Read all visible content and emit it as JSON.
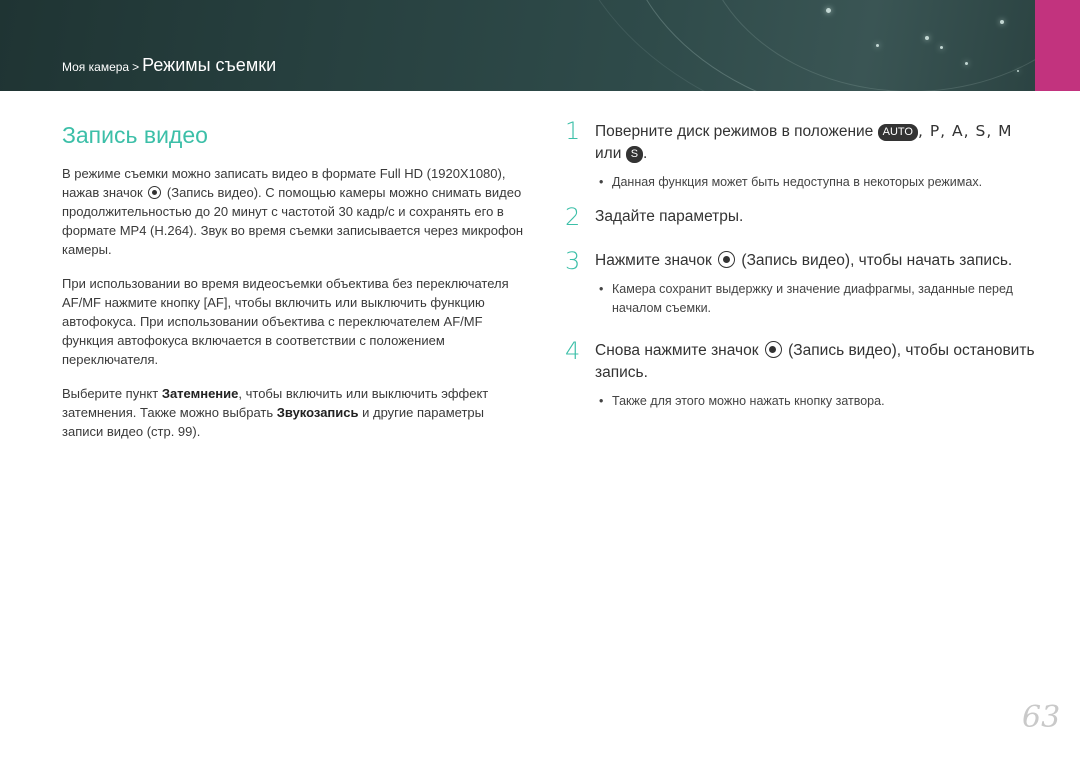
{
  "header": {
    "breadcrumb_parent": "Моя камера",
    "breadcrumb_separator": ">",
    "breadcrumb_current": "Режимы съемки"
  },
  "section": {
    "title": "Запись видео"
  },
  "left": {
    "p1_a": "В режиме съемки можно записать видео в формате Full HD (1920X1080), нажав значок",
    "p1_b": "(Запись видео). С помощью камеры можно снимать видео продолжительностью до 20 минут с частотой 30 кадр/с и сохранять его в формате MP4 (H.264). Звук во время съемки записывается через микрофон камеры.",
    "p2_a": "При использовании во время видеосъемки объектива без переключателя AF/MF нажмите кнопку [",
    "p2_af": "AF",
    "p2_b": "], чтобы включить или выключить функцию автофокуса. При использовании объектива с переключателем AF/MF функция автофокуса включается в соответствии с положением переключателя.",
    "p3_a": "Выберите пункт ",
    "p3_bold1": "Затемнение",
    "p3_b": ", чтобы включить или выключить эффект затемнения. Также можно выбрать ",
    "p3_bold2": "Звукозапись",
    "p3_c": " и другие параметры записи видео (стр. 99)."
  },
  "steps": [
    {
      "num": "1",
      "text_a": "Поверните диск режимов в положение ",
      "badge": "AUTO",
      "letters": ", P, A, S, M",
      "text_b": "или",
      "badge2": "S",
      "text_c": ".",
      "note": "Данная функция может быть недоступна в некоторых режимах."
    },
    {
      "num": "2",
      "text": "Задайте параметры."
    },
    {
      "num": "3",
      "text_a": "Нажмите значок",
      "text_b": "(Запись видео), чтобы начать запись.",
      "note": "Камера сохранит выдержку и значение диафрагмы, заданные перед началом съемки."
    },
    {
      "num": "4",
      "text_a": "Снова нажмите значок",
      "text_b": "(Запись видео), чтобы остановить запись.",
      "note": "Также для этого можно нажать кнопку затвора."
    }
  ],
  "footer": {
    "page_number": "63"
  },
  "colors": {
    "accent": "#3cbfa8",
    "banner": "#27403f",
    "tab": "#c2337e"
  }
}
